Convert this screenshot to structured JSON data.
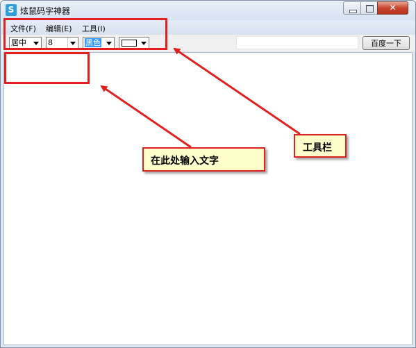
{
  "window": {
    "title": "炫鼠码字神器",
    "icon": "app-icon",
    "controls": {
      "close_glyph": "✕"
    }
  },
  "menu": {
    "items": [
      "文件(F)",
      "编辑(E)",
      "工具(I)"
    ]
  },
  "toolbar": {
    "align_value": "居中",
    "size_value": "8",
    "color_value": "黑色",
    "search_placeholder": "",
    "search_button_label": "百度一下"
  },
  "annotations": {
    "input_area_label": "在此处输入文字",
    "toolbar_label": "工具栏",
    "highlight_color": "#e32020",
    "callout_bg": "#ffffcc"
  }
}
